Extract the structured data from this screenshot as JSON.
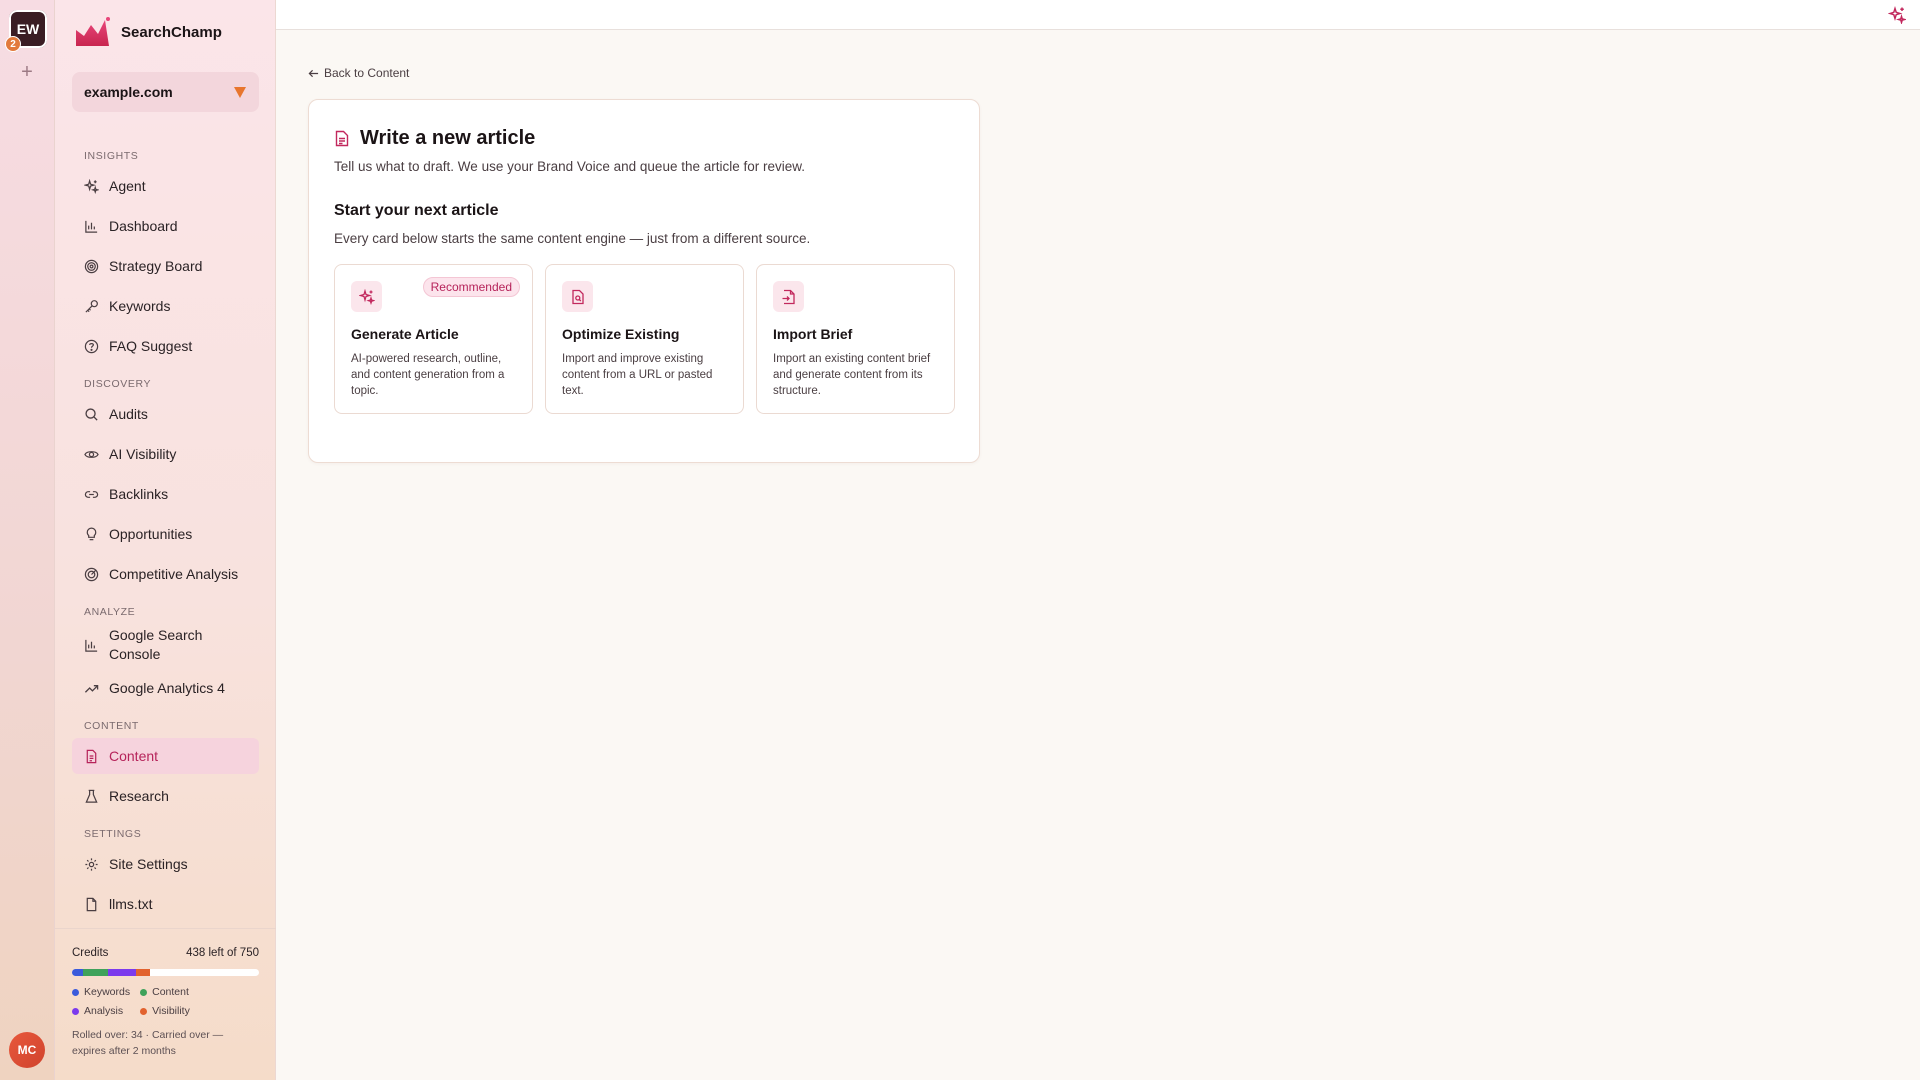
{
  "rail": {
    "workspace_initials": "EW",
    "workspace_badge": "2",
    "add_symbol": "+",
    "user_initials": "MC"
  },
  "brand": {
    "name": "SearchChamp",
    "accent": "#d63a6b"
  },
  "site_selector": {
    "value": "example.com"
  },
  "nav": {
    "insights_label": "INSIGHTS",
    "insights": [
      {
        "label": "Agent",
        "icon": "sparkles-icon"
      },
      {
        "label": "Dashboard",
        "icon": "bar-chart-icon"
      },
      {
        "label": "Strategy Board",
        "icon": "target-icon"
      },
      {
        "label": "Keywords",
        "icon": "key-icon"
      },
      {
        "label": "FAQ Suggest",
        "icon": "question-circle-icon"
      }
    ],
    "discovery_label": "DISCOVERY",
    "discovery": [
      {
        "label": "Audits",
        "icon": "search-icon"
      },
      {
        "label": "AI Visibility",
        "icon": "eye-icon"
      },
      {
        "label": "Backlinks",
        "icon": "link-icon"
      },
      {
        "label": "Opportunities",
        "icon": "lightbulb-icon"
      },
      {
        "label": "Competitive Analysis",
        "icon": "radar-icon"
      }
    ],
    "analyze_label": "ANALYZE",
    "analyze": [
      {
        "label": "Google Search Console",
        "icon": "bar-chart-icon"
      },
      {
        "label": "Google Analytics 4",
        "icon": "trending-up-icon"
      }
    ],
    "content_label": "CONTENT",
    "content": [
      {
        "label": "Content",
        "icon": "document-icon",
        "active": true
      },
      {
        "label": "Research",
        "icon": "flask-icon"
      }
    ],
    "settings_label": "SETTINGS",
    "settings": [
      {
        "label": "Site Settings",
        "icon": "gear-icon"
      },
      {
        "label": "llms.txt",
        "icon": "file-icon"
      }
    ]
  },
  "credits": {
    "label": "Credits",
    "remaining_text": "438 left of 750",
    "used_fraction": 0.416,
    "segments": [
      {
        "name": "Keywords",
        "color": "#3b5bdb",
        "fraction": 0.06
      },
      {
        "name": "Content",
        "color": "#3fa25b",
        "fraction": 0.13
      },
      {
        "name": "Analysis",
        "color": "#7c3aed",
        "fraction": 0.15
      },
      {
        "name": "Visibility",
        "color": "#e2622e",
        "fraction": 0.076
      }
    ],
    "legend": [
      "Keywords",
      "Content",
      "Analysis",
      "Visibility"
    ],
    "rollover_text": "Rolled over: 34 · Carried over — expires after 2 months"
  },
  "main": {
    "back_label": "Back to Content",
    "title": "Write a new article",
    "subtitle": "Tell us what to draft. We use your Brand Voice and queue the article for review.",
    "start_title": "Start your next article",
    "start_subtitle": "Every card below starts the same content engine — just from a different source.",
    "options": [
      {
        "title": "Generate Article",
        "badge": "Recommended",
        "description": "AI-powered research, outline, and content generation from a topic.",
        "icon": "sparkles-icon"
      },
      {
        "title": "Optimize Existing",
        "description": "Import and improve existing content from a URL or pasted text.",
        "icon": "document-search-icon"
      },
      {
        "title": "Import Brief",
        "description": "Import an existing content brief and generate content from its structure.",
        "icon": "file-import-icon"
      }
    ]
  }
}
